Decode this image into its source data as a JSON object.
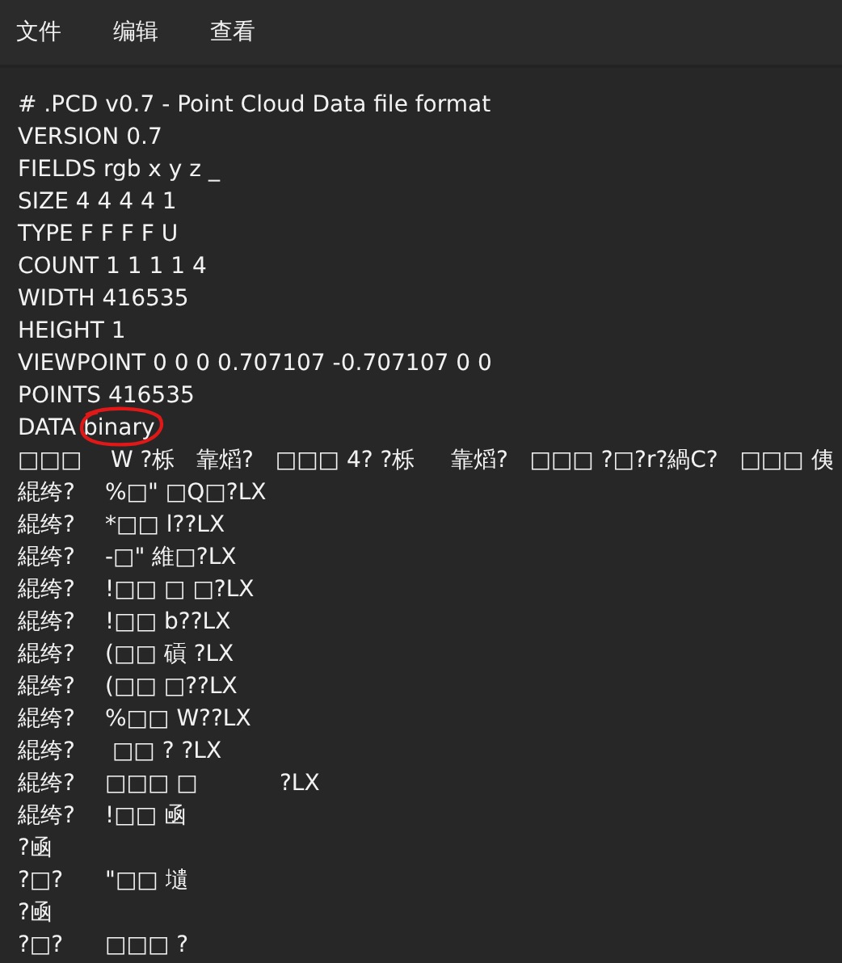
{
  "menu": [
    {
      "label": "文件"
    },
    {
      "label": "编辑"
    },
    {
      "label": "查看"
    }
  ],
  "lines": [
    {
      "text": "# .PCD v0.7 - Point Cloud Data file format"
    },
    {
      "text": "VERSION 0.7"
    },
    {
      "text": "FIELDS rgb x y z _"
    },
    {
      "text": "SIZE 4 4 4 4 1"
    },
    {
      "text": "TYPE F F F F U"
    },
    {
      "text": "COUNT 1 1 1 1 4"
    },
    {
      "text": "WIDTH 416535"
    },
    {
      "text": "HEIGHT 1"
    },
    {
      "text": "VIEWPOINT 0 0 0 0.707107 -0.707107 0 0"
    },
    {
      "text": "POINTS 416535"
    },
    {
      "parts": [
        {
          "text": "DATA ",
          "circled": false
        },
        {
          "text": "binary",
          "circled": true
        }
      ]
    },
    {
      "text": "□□□    W ?栎   靠熖?   □□□ 4? ?栎     靠熖?   □□□ ?□?r?緺C?   □□□ 侇"
    },
    {
      "text": "緄绔?\t%□\" □Q□?LX"
    },
    {
      "text": "緄绔?\t*□□ l??LX"
    },
    {
      "text": "緄绔?\t-□\" 維□?LX"
    },
    {
      "text": "緄绔?\t!□□ □ □?LX"
    },
    {
      "text": "緄绔?\t!□□ b??LX"
    },
    {
      "text": "緄绔?\t(□□ 碽 ?LX"
    },
    {
      "text": "緄绔?\t(□□ □??LX"
    },
    {
      "text": "緄绔?\t%□□ W??LX"
    },
    {
      "text": "緄绔?\t □□ ? ?LX"
    },
    {
      "text": "緄绔?\t□□□ □\t?LX"
    },
    {
      "text": "緄绔?\t!□□ 凾"
    },
    {
      "text": "?凾"
    },
    {
      "text": "?□?\t\"□□ 壝"
    },
    {
      "text": "?凾"
    },
    {
      "text": "?□?\t□□□ ?"
    }
  ]
}
